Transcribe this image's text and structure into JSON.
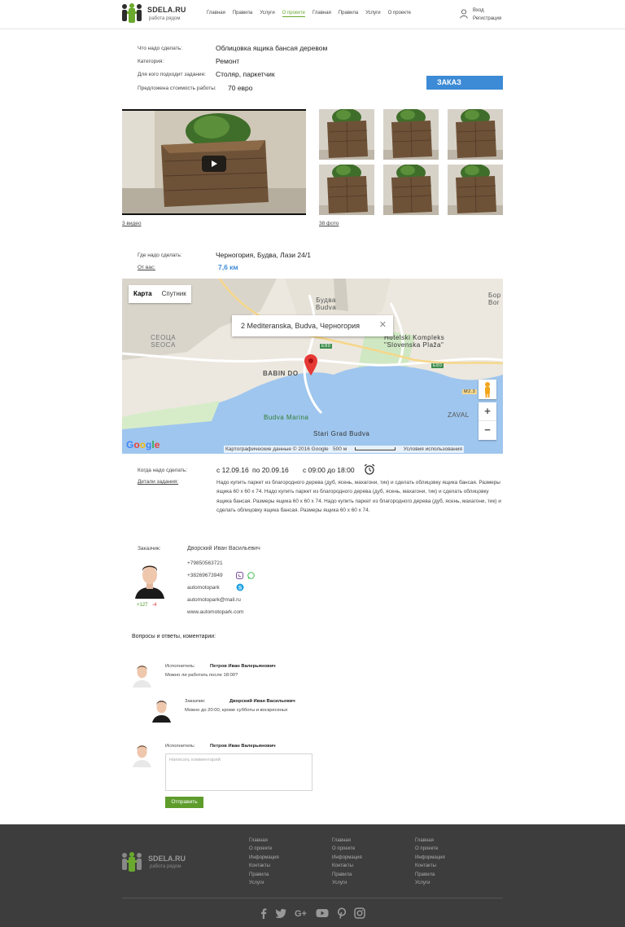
{
  "header": {
    "brand": "SDELA.RU",
    "tagline": "работа рядом",
    "nav": [
      "Главная",
      "Правила",
      "Услуги",
      "О проекте",
      "Главная",
      "Правила",
      "Услуги",
      "О проекте"
    ],
    "active_nav_index": 3,
    "login": "Вход",
    "register": "Регистрация"
  },
  "task": {
    "what_label": "Что надо сделать:",
    "what_value": "Облицовка ящика бансая деревом",
    "category_label": "Категория:",
    "category_value": "Ремонт",
    "for_whom_label": "Для кого подходит задание:",
    "for_whom_value": "Столяр, паркетчик",
    "price_label": "Предложена стоимость работы:",
    "price_value": "70 евро",
    "order_button": "ЗАКАЗ"
  },
  "media": {
    "videos_link": "3 видео",
    "photos_link": "38 фото"
  },
  "location": {
    "where_label": "Где надо сделать:",
    "where_value": "Черногория, Будва, Лази 24/1",
    "distance_label": "От вас:",
    "distance_value": "7,6 км"
  },
  "map": {
    "type_map": "Карта",
    "type_satellite": "Спутник",
    "popup": "2 Mediteranska, Budva, Черногория",
    "popup_close": "✕",
    "zoom_in": "+",
    "zoom_out": "−",
    "logo": "Google",
    "footer_data": "Картографические данные © 2016 Google",
    "footer_scale": "500 м",
    "footer_terms": "Условия использования",
    "labels": {
      "budva": "Будва\nBudva",
      "seoca": "СЕОЦА\nSEOCA",
      "babin_do": "BABIN DO",
      "hotel": "Hotelski Kompleks\n\"Slovenska Plaža\"",
      "marina": "Budva Marina",
      "stari_grad": "Stari Grad Budva",
      "zaval": "ZAVAL",
      "bor": "Бор\nBor",
      "e80a": "E80",
      "e80b": "E80",
      "m23": "M2.3"
    }
  },
  "schedule": {
    "when_label": "Когда надо сделать:",
    "date_from": "с 12.09.16",
    "date_to": "по 20.09.16",
    "time": "с 09:00 до 18:00",
    "details_label": "Детали задания:",
    "details_text": "Надо купить паркет из благородного дерева (дуб, ясень, махагони, тик) и сделать облицовку ящика бансая. Размеры ящика 60 х 60 х 74.  Надо купить паркет из благородного дерева (дуб, ясень, махагони, тик) и сделать облицовку ящика бансая. Размеры ящика 60 х 60 х 74.  Надо купить паркет из благородного дерева (дуб, ясень, махагони, тик) и сделать облицовку ящика бансая. Размеры ящика 60 х 60 х 74."
  },
  "customer": {
    "label": "Заказчик:",
    "name": "Дворский Иван Васильевич",
    "phone1": "+79850563721",
    "phone2": "+38269673949",
    "skype": "automotopark",
    "email": "automotopark@mail.ru",
    "site": "www.automotopark.com",
    "rating_plus": "+127",
    "rating_minus": "-4"
  },
  "comments": {
    "title": "Вопросы и ответы, коментарии:",
    "items": [
      {
        "role": "Исполнитель:",
        "name": "Петров Иван Валерьянович",
        "text": "Можно ли работать после 18:00?"
      },
      {
        "role": "Заказчик:",
        "name": "Дворский Иван Васильевич",
        "text": "Можно до 20:00, кроме субботы и воскресенья"
      }
    ],
    "form_role": "Исполнитель:",
    "form_name": "Петров Иван Валерьянович",
    "placeholder": "Написать комментарий",
    "send": "Отправить"
  },
  "footer": {
    "brand": "SDELA.RU",
    "tagline": "работа рядом",
    "columns": [
      [
        "Главная",
        "О проекте",
        "Информация",
        "Контакты",
        "Правила",
        "Услуги"
      ],
      [
        "Главная",
        "О проекте",
        "Информация",
        "Контакты",
        "Правила",
        "Услуги"
      ],
      [
        "Главная",
        "О проекте",
        "Информация",
        "Контакты",
        "Правила",
        "Услуги"
      ]
    ],
    "social": [
      "facebook-icon",
      "twitter-icon",
      "google-plus-icon",
      "youtube-icon",
      "pinterest-icon",
      "instagram-icon"
    ]
  },
  "colors": {
    "accent_green": "#6aa92e",
    "order_blue": "#3d8bd6",
    "send_green": "#5e9c2c",
    "footer_bg": "#3d3d3d"
  }
}
